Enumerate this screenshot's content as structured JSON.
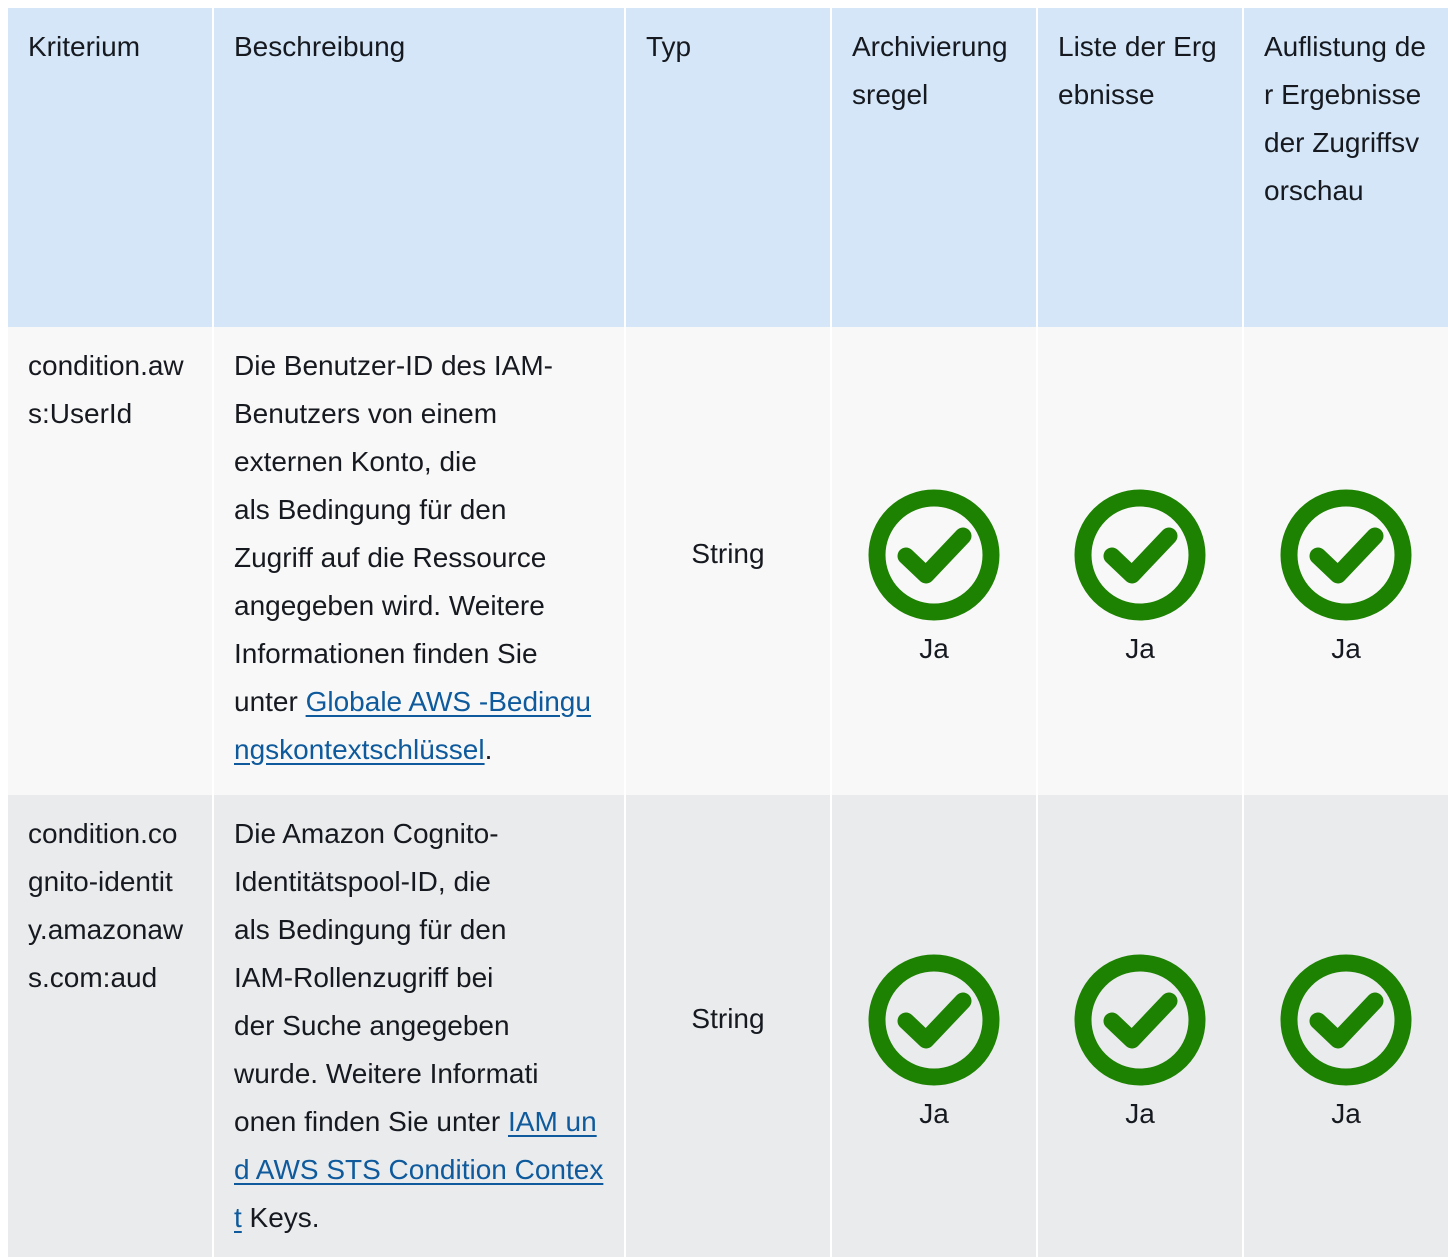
{
  "header": {
    "col_criterion": "Kriterium",
    "col_description": "Beschreibung",
    "col_type": "Typ",
    "col_archive_rule": "Archivierungsregel",
    "col_list_findings": "Liste der Ergebnisse",
    "col_list_access_preview": "Auflistung der Ergebnisse der Zugriffsvorschau"
  },
  "rows": [
    {
      "criterion": "condition.aws:UserId",
      "description_lines": [
        "Die Benutzer-ID des IAM-",
        "Benutzers von einem",
        "externen Konto, die",
        "als Bedingung für den",
        "Zugriff auf die Ressource",
        "angegeben wird. Weitere",
        "Informationen finden Sie"
      ],
      "description_prefix": "unter ",
      "link_text": "Globale AWS -Bedingungskontextschlüssel",
      "description_suffix": ".",
      "type": "String",
      "archive_rule": "Ja",
      "list_findings": "Ja",
      "list_access_preview": "Ja"
    },
    {
      "criterion": "condition.cognito-identity.amazonaws.com:aud",
      "description_lines": [
        "Die Amazon Cognito-",
        "Identitätspool-ID, die",
        "als Bedingung für den",
        "IAM-Rollenzugriff bei",
        "der Suche angegeben",
        "wurde. Weitere Informati"
      ],
      "description_prefix": "onen finden Sie unter ",
      "link_text": "IAM und AWS STS Condition Context",
      "description_suffix": " Keys.",
      "type": "String",
      "archive_rule": "Ja",
      "list_findings": "Ja",
      "list_access_preview": "Ja"
    }
  ],
  "colors": {
    "header_bg": "#d4e6f7",
    "row1_bg": "#f8f8f8",
    "row2_bg": "#e9ebed",
    "check_green": "#1d8102",
    "link": "#0e5a9c"
  },
  "icons": {
    "yes": "check-circle-icon"
  }
}
